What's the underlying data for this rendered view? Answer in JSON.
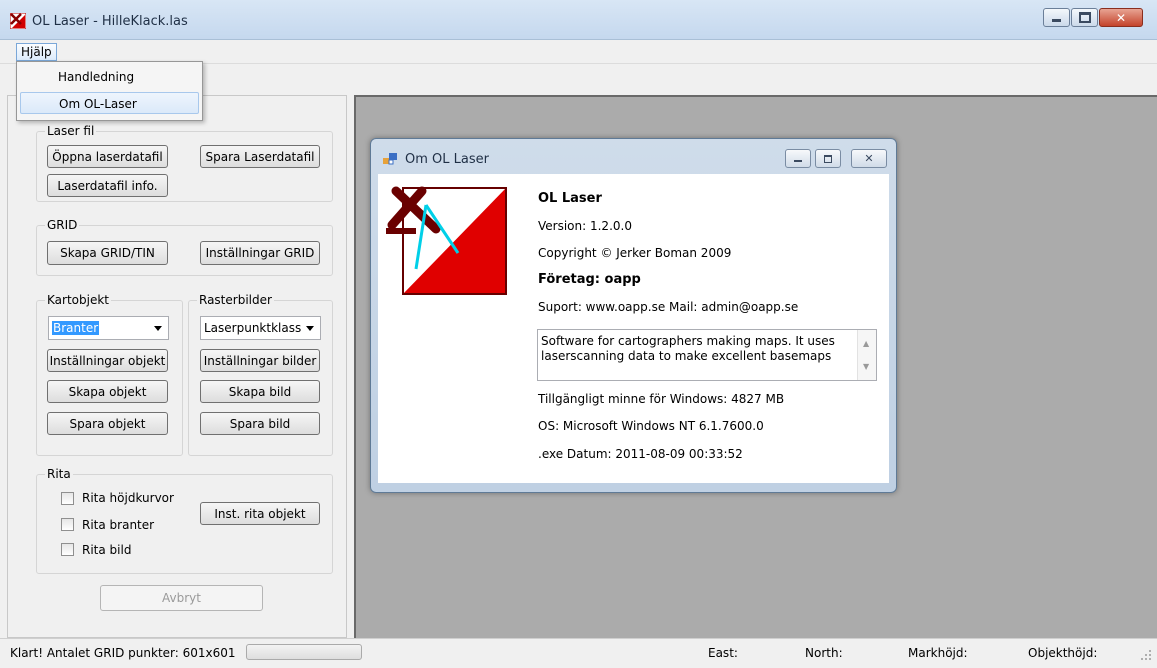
{
  "window": {
    "title": "OL Laser - HilleKlack.las"
  },
  "menu": {
    "help_label": "Hjälp",
    "items": [
      "Handledning",
      "Om OL-Laser"
    ]
  },
  "laser_file": {
    "legend": "Laser fil",
    "open_label": "Öppna laserdatafil",
    "save_label": "Spara Laserdatafil",
    "info_label": "Laserdatafil info."
  },
  "grid": {
    "legend": "GRID",
    "create_label": "Skapa GRID/TIN",
    "settings_label": "Inställningar GRID"
  },
  "objects": {
    "legend": "Kartobjekt",
    "selected": "Branter",
    "settings_label": "Inställningar objekt",
    "create_label": "Skapa objekt",
    "save_label": "Spara objekt"
  },
  "raster": {
    "legend": "Rasterbilder",
    "selected": "Laserpunktklass",
    "settings_label": "Inställningar bilder",
    "create_label": "Skapa bild",
    "save_label": "Spara bild"
  },
  "draw": {
    "legend": "Rita",
    "checkboxes": [
      "Rita höjdkurvor",
      "Rita branter",
      "Rita bild"
    ],
    "settings_label": "Inst. rita objekt"
  },
  "cancel_label": "Avbryt",
  "about": {
    "title": "Om OL Laser",
    "product": "OL Laser",
    "version": "Version: 1.2.0.0",
    "copyright": "Copyright © Jerker Boman 2009",
    "company": "Företag: oapp",
    "support": "Suport: www.oapp.se  Mail: admin@oapp.se",
    "description": "Software for cartographers making maps. It uses laserscanning data to make excellent basemaps",
    "memory": "Tillgängligt minne för Windows: 4827 MB",
    "os": "OS: Microsoft Windows NT 6.1.7600.0",
    "exe_date": ".exe Datum: 2011-08-09 00:33:52"
  },
  "status": {
    "message": "Klart! Antalet GRID punkter: 601x601",
    "east": "East:",
    "north": "North:",
    "ground_height": "Markhöjd:",
    "object_height": "Objekthöjd:"
  }
}
